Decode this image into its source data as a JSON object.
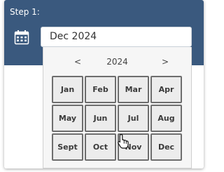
{
  "step": {
    "label": "Step 1:"
  },
  "date_field": {
    "value": "Dec 2024"
  },
  "picker": {
    "prev_label": "<",
    "year": "2024",
    "next_label": ">",
    "months": [
      "Jan",
      "Feb",
      "Mar",
      "Apr",
      "May",
      "Jun",
      "Jul",
      "Aug",
      "Sept",
      "Oct",
      "Nov",
      "Dec"
    ]
  },
  "colors": {
    "header_band": "#3a597e",
    "picker_bg": "#f6f6f6",
    "month_border": "#6e6e6e"
  },
  "icons": {
    "calendar": "calendar-icon",
    "cursor": "hand-pointer-icon"
  }
}
